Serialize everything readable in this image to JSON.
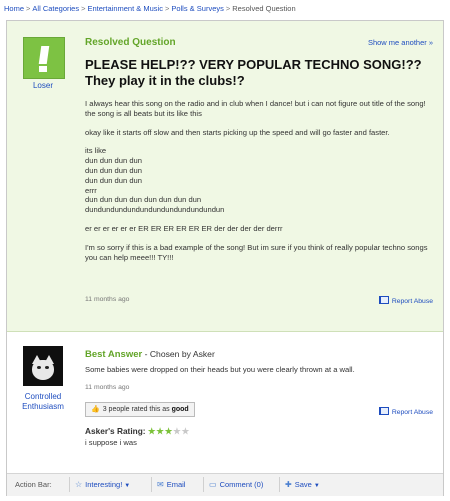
{
  "breadcrumb": {
    "items": [
      "Home",
      "All Categories",
      "Entertainment & Music",
      "Polls & Surveys",
      "Resolved Question"
    ],
    "separator": ">"
  },
  "question": {
    "status": "Resolved Question",
    "show_more": "Show me another »",
    "asker_name": "Loser",
    "title": "PLEASE HELP!?? VERY POPULAR TECHNO SONG!?? They play it in the clubs!?",
    "body": [
      "I always hear this song on the radio and in club when I dance! but i can not figure out title of the song! the song is all beats but its like this",
      "okay like it starts off slow and then starts picking up the speed and will go faster and faster."
    ],
    "lines": [
      "its like",
      "dun dun dun dun",
      "dun dun dun dun",
      "dun dun dun dun",
      "errr",
      "dun dun dun dun dun dun dun dun",
      "dundundundundundundundundundundun"
    ],
    "er_line": "er er er er er er ER ER ER ER ER ER der der der der derrr",
    "closing": "I'm so sorry if this is a bad example of the song! But im sure if you think of really popular techno songs you can help meee!!! TY!!!",
    "time": "11 months ago",
    "report": "Report Abuse"
  },
  "answer": {
    "label": "Best Answer",
    "chosen_by": "- Chosen by Asker",
    "answerer_name": "Controlled Enthusiasm",
    "body": "Some babies were dropped on their heads but you were clearly thrown at a wall.",
    "time": "11 months ago",
    "report": "Report Abuse",
    "rated_text": "3 people rated this as",
    "rated_value": "good",
    "asker_rating_label": "Asker's Rating:",
    "stars_on": "★★★",
    "stars_off": "★★",
    "rating": 3,
    "rating_max": 5,
    "asker_comment": "i suppose i was"
  },
  "action_bar": {
    "label": "Action Bar:",
    "interesting": "Interesting!",
    "email": "Email",
    "comment": "Comment (0)",
    "save": "Save"
  },
  "colors": {
    "accent_green": "#63a529",
    "link_blue": "#1e4dbf",
    "question_bg": "#f0f8e4"
  }
}
